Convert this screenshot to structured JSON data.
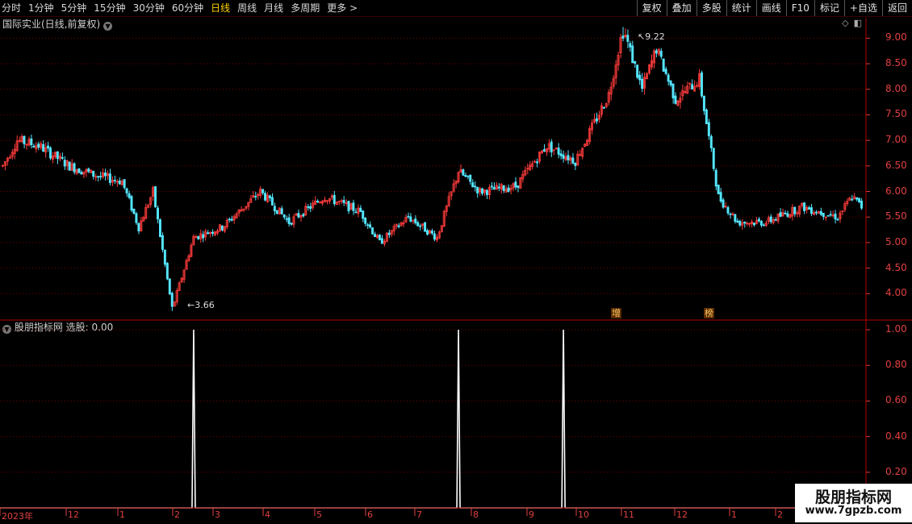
{
  "toolbar": {
    "periods": [
      {
        "label": "分时",
        "active": false
      },
      {
        "label": "1分钟",
        "active": false
      },
      {
        "label": "5分钟",
        "active": false
      },
      {
        "label": "15分钟",
        "active": false
      },
      {
        "label": "30分钟",
        "active": false
      },
      {
        "label": "60分钟",
        "active": false
      },
      {
        "label": "日线",
        "active": true
      },
      {
        "label": "周线",
        "active": false
      },
      {
        "label": "月线",
        "active": false
      },
      {
        "label": "多周期",
        "active": false
      },
      {
        "label": "更多 >",
        "active": false
      }
    ],
    "actions": [
      "复权",
      "叠加",
      "多股",
      "统计",
      "画线",
      "F10",
      "标记",
      "+自选",
      "返回"
    ]
  },
  "main_panel": {
    "title": "国际实业(日线,前复权)",
    "high_label": "9.22",
    "low_label": "3.66",
    "tags": [
      "增",
      "榜"
    ]
  },
  "indicator_panel": {
    "title": "股朋指标网",
    "value_text": "选股: 0.00"
  },
  "colors": {
    "up": "#ff3c3c",
    "down": "#54e6ff",
    "grid": "#7a0000",
    "axis": "#e04040",
    "signal": "#ffffff"
  },
  "watermark": {
    "line1": "股朋指标网",
    "line2": "www.7gpzb.com"
  },
  "chart_data": [
    {
      "type": "candlestick",
      "y_ticks": [
        "9.00",
        "8.50",
        "8.00",
        "7.50",
        "7.00",
        "6.50",
        "6.00",
        "5.50",
        "5.00",
        "4.50",
        "4.00"
      ],
      "ylim": [
        3.5,
        9.4
      ],
      "x_labels": [
        "2023年",
        "12",
        "1",
        "2",
        "3",
        "4",
        "5",
        "6",
        "7",
        "8",
        "9",
        "10",
        "11",
        "12",
        "1",
        "2"
      ],
      "keypoints": [
        [
          0,
          6.5
        ],
        [
          6,
          7.0
        ],
        [
          15,
          6.9
        ],
        [
          28,
          6.5
        ],
        [
          40,
          6.3
        ],
        [
          50,
          6.2
        ],
        [
          57,
          5.3
        ],
        [
          63,
          6.0
        ],
        [
          71,
          3.7
        ],
        [
          80,
          5.1
        ],
        [
          92,
          5.3
        ],
        [
          108,
          6.0
        ],
        [
          120,
          5.4
        ],
        [
          135,
          5.9
        ],
        [
          150,
          5.6
        ],
        [
          158,
          5.0
        ],
        [
          170,
          5.5
        ],
        [
          182,
          5.1
        ],
        [
          191,
          6.4
        ],
        [
          200,
          6.0
        ],
        [
          215,
          6.1
        ],
        [
          228,
          6.9
        ],
        [
          240,
          6.6
        ],
        [
          254,
          7.9
        ],
        [
          260,
          9.2
        ],
        [
          268,
          8.0
        ],
        [
          274,
          8.8
        ],
        [
          282,
          7.8
        ],
        [
          292,
          8.2
        ],
        [
          300,
          5.9
        ],
        [
          308,
          5.4
        ],
        [
          320,
          5.4
        ],
        [
          335,
          5.7
        ],
        [
          350,
          5.5
        ],
        [
          356,
          5.9
        ],
        [
          360,
          5.7
        ]
      ],
      "high": 9.22,
      "low": 3.66
    },
    {
      "type": "line",
      "name": "选股",
      "y_ticks": [
        "1.00",
        "0.80",
        "0.60",
        "0.40",
        "0.20"
      ],
      "ylim": [
        0,
        1.05
      ],
      "spike_at": [
        80,
        191,
        235
      ],
      "values_at_spike": 1.0,
      "baseline": 0.0
    }
  ]
}
